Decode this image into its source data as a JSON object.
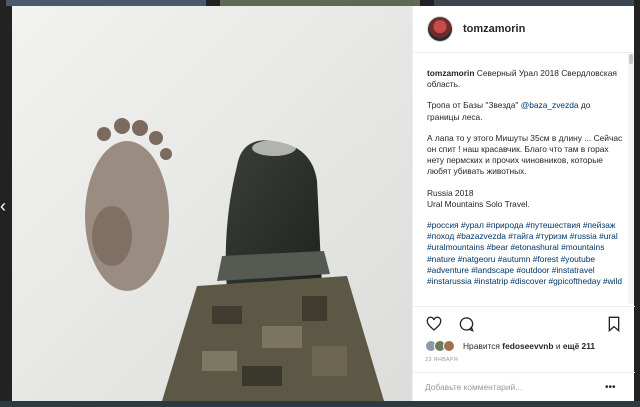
{
  "post": {
    "username": "tomzamorin",
    "caption": {
      "lines_1": "Северный Урал 2018 Свердловская область.",
      "para_2_a": "Тропа от Базы \"Звезда\"",
      "para_2_mention": "@baza_zvezda",
      "para_2_b": " до границы леса.",
      "para_3": "А лапа то у этого Мишуты 35см в длину ... Сейчас он спит ! наш красавчик. Благо что там в горах нету пермских и прочих чиновников, которые любят убивать животных.",
      "para_4_l1": "Russia 2018",
      "para_4_l2": "Ural Mountains Solo Travel.",
      "hashtags": "#россия #урал #природа #путешествия #пейзаж #поход #bazazvezda #тайга #туризм #russia #ural #uralmountains #bear #etonashural #mountains #nature #natgeoru #autumn #forest #youtube #adventure #landscape #outdoor #instatravel #instarussia #instatrip #discover #gpicoftheday #wild"
    },
    "likes": {
      "prefix": "Нравится",
      "user": "fedoseevvnb",
      "conj": "и",
      "others": "ещё 211"
    },
    "date": "23 ЯНВАРЯ",
    "comment_placeholder": "Добавьте комментарий...",
    "more_glyph": "•••"
  },
  "icons": {
    "like": "heart-icon",
    "comment": "comment-icon",
    "share": "share-icon",
    "save": "bookmark-icon",
    "prev": "chevron-left-icon"
  },
  "nav": {
    "prev_glyph": "‹"
  }
}
